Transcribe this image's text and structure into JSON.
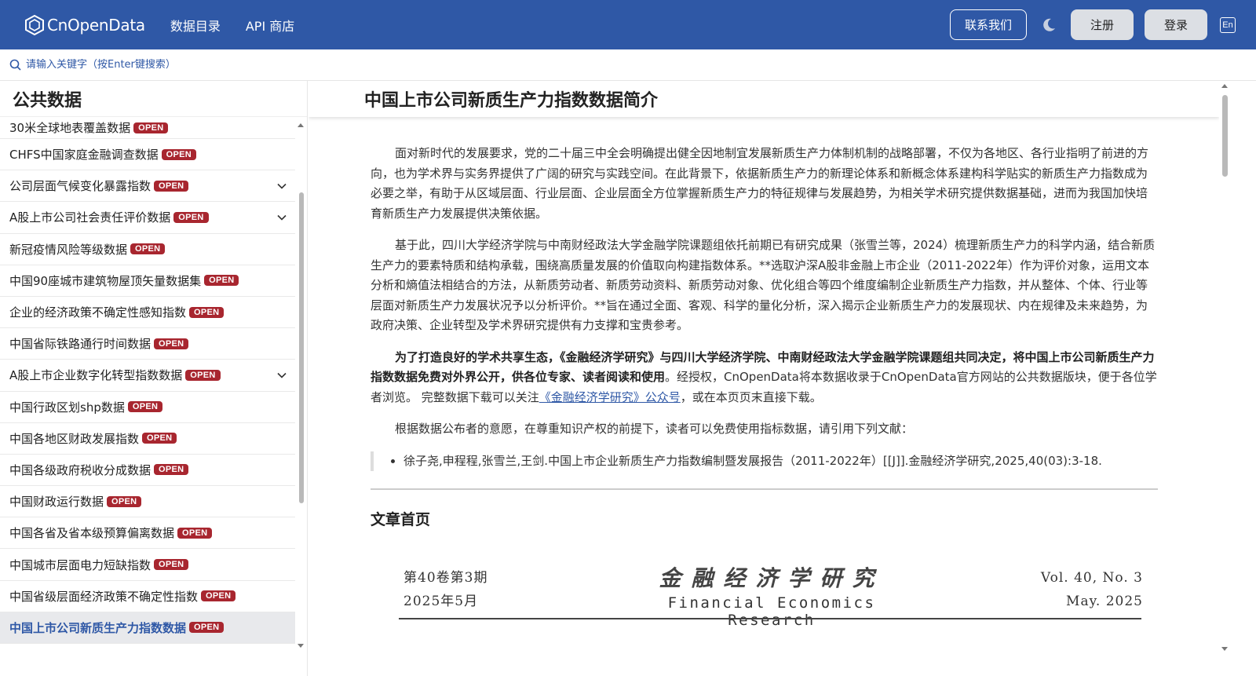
{
  "header": {
    "logo_text": "CnOpenData",
    "nav": [
      "数据目录",
      "API 商店"
    ],
    "contact_label": "联系我们",
    "register_label": "注册",
    "login_label": "登录",
    "lang_label": "En"
  },
  "search": {
    "placeholder": "请输入关键字（按Enter键搜索）"
  },
  "sidebar": {
    "title": "公共数据",
    "badge": "OPEN",
    "items": [
      {
        "label": "30米全球地表覆盖数据",
        "expand": false
      },
      {
        "label": "CHFS中国家庭金融调查数据",
        "expand": false
      },
      {
        "label": "公司层面气候变化暴露指数",
        "expand": true
      },
      {
        "label": "A股上市公司社会责任评价数据",
        "expand": true
      },
      {
        "label": "新冠疫情风险等级数据",
        "expand": false
      },
      {
        "label": "中国90座城市建筑物屋顶矢量数据集",
        "expand": false
      },
      {
        "label": "企业的经济政策不确定性感知指数",
        "expand": false
      },
      {
        "label": "中国省际铁路通行时间数据",
        "expand": false
      },
      {
        "label": "A股上市企业数字化转型指数数据",
        "expand": true
      },
      {
        "label": "中国行政区划shp数据",
        "expand": false
      },
      {
        "label": "中国各地区财政发展指数",
        "expand": false
      },
      {
        "label": "中国各级政府税收分成数据",
        "expand": false
      },
      {
        "label": "中国财政运行数据",
        "expand": false
      },
      {
        "label": "中国各省及省本级预算偏离数据",
        "expand": false
      },
      {
        "label": "中国城市层面电力短缺指数",
        "expand": false
      },
      {
        "label": "中国省级层面经济政策不确定性指数",
        "expand": false
      },
      {
        "label": "中国上市公司新质生产力指数数据",
        "expand": false,
        "active": true
      }
    ]
  },
  "main": {
    "title": "中国上市公司新质生产力指数数据简介",
    "p1": "面对新时代的发展要求，党的二十届三中全会明确提出健全因地制宜发展新质生产力体制机制的战略部署，不仅为各地区、各行业指明了前进的方向，也为学术界与实务界提供了广阔的研究与实践空间。在此背景下，依据新质生产力的新理论体系和新概念体系建构科学贴实的新质生产力指数成为必要之举，有助于从区域层面、行业层面、企业层面全方位掌握新质生产力的特征规律与发展趋势，为相关学术研究提供数据基础，进而为我国加快培育新质生产力发展提供决策依据。",
    "p2": "基于此，四川大学经济学院与中南财经政法大学金融学院课题组依托前期已有研究成果（张雪兰等，2024）梳理新质生产力的科学内涵，结合新质生产力的要素特质和结构承载，围绕高质量发展的价值取向构建指数体系。**选取沪深A股非金融上市企业（2011-2022年）作为评价对象，运用文本分析和熵值法相结合的方法，从新质劳动者、新质劳动资料、新质劳动对象、优化组合等四个维度编制企业新质生产力指数，并从整体、个体、行业等层面对新质生产力发展状况予以分析评价。**旨在通过全面、客观、科学的量化分析，深入揭示企业新质生产力的发展现状、内在规律及未来趋势，为政府决策、企业转型及学术界研究提供有力支撑和宝贵参考。",
    "p3_bold": "为了打造良好的学术共享生态，《金融经济学研究》与四川大学经济学院、中南财经政法大学金融学院课题组共同决定，将中国上市公司新质生产力指数数据免费对外界公开，供各位专家、读者阅读和使用",
    "p3_rest": "。经授权，CnOpenData将本数据收录于CnOpenData官方网站的公共数据版块，便于各位学者浏览。 完整数据下载可以关注",
    "p3_link": "《金融经济学研究》公众号",
    "p3_tail": "，或在本页页末直接下载。",
    "p4": "根据数据公布者的意愿，在尊重知识产权的前提下，读者可以免费使用指标数据，请引用下列文献：",
    "citation": "徐子尧,申程程,张雪兰,王剑.中国上市企业新质生产力指数编制暨发展报告（2011-2022年）[[J]].金融经济学研究,2025,40(03):3-18.",
    "section_title": "文章首页",
    "journal": {
      "issue_cn": "第40卷第3期",
      "date_cn": "2025年5月",
      "name_cn": "金融经济学研究",
      "name_en": "Financial Economics Research",
      "vol_en": "Vol. 40, No. 3",
      "date_en": "May. 2025"
    }
  }
}
